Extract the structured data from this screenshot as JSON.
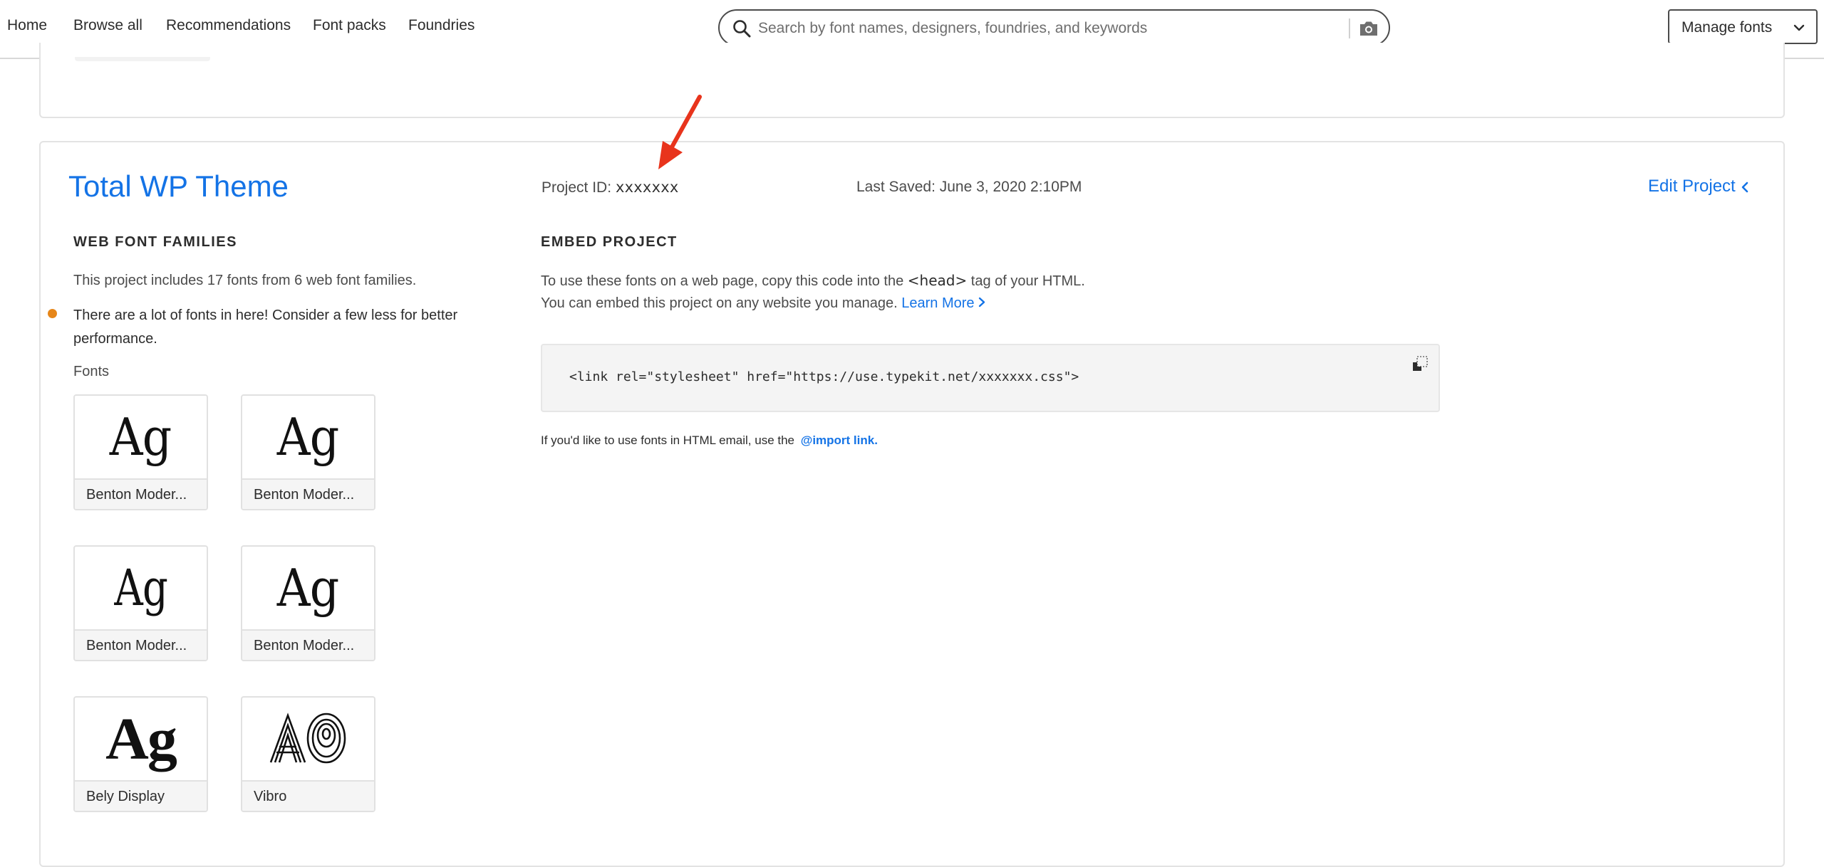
{
  "nav": {
    "links": [
      "Home",
      "Browse all",
      "Recommendations",
      "Font packs",
      "Foundries"
    ],
    "search_placeholder": "Search by font names, designers, foundries, and keywords",
    "manage_fonts": "Manage fonts"
  },
  "project": {
    "title": "Total WP Theme",
    "id_label": "Project ID:",
    "id_value": "xxxxxxx",
    "last_saved": "Last Saved: June 3, 2020 2:10PM",
    "edit_label": "Edit Project"
  },
  "web_fonts": {
    "heading": "WEB FONT FAMILIES",
    "summary": "This project includes 17 fonts from 6 web font families.",
    "warning": "There are a lot of fonts in here! Consider a few less for better performance.",
    "fonts_label": "Fonts",
    "tiles": [
      {
        "sample": "Ag",
        "name": "Benton Moder..."
      },
      {
        "sample": "Ag",
        "name": "Benton Moder..."
      },
      {
        "sample": "Ag",
        "name": "Benton Moder..."
      },
      {
        "sample": "Ag",
        "name": "Benton Moder..."
      },
      {
        "sample": "Ag",
        "name": "Bely Display"
      },
      {
        "sample": "Ag",
        "name": "Vibro"
      }
    ]
  },
  "embed": {
    "heading": "EMBED PROJECT",
    "line1_prefix": "To use these fonts on a web page, copy this code into the ",
    "line1_tag": "<head>",
    "line1_suffix": " tag of your HTML.",
    "line2": "You can embed this project on any website you manage.",
    "learn_more": "Learn More",
    "code": "<link rel=\"stylesheet\" href=\"https://use.typekit.net/xxxxxxx.css\">",
    "email_text": "If you'd like to use fonts in HTML email, use the",
    "import_link": "@import link",
    "email_suffix": "."
  },
  "colors": {
    "accent": "#1473e6",
    "warning_dot": "#e68619",
    "annotation_arrow": "#e8341c"
  }
}
